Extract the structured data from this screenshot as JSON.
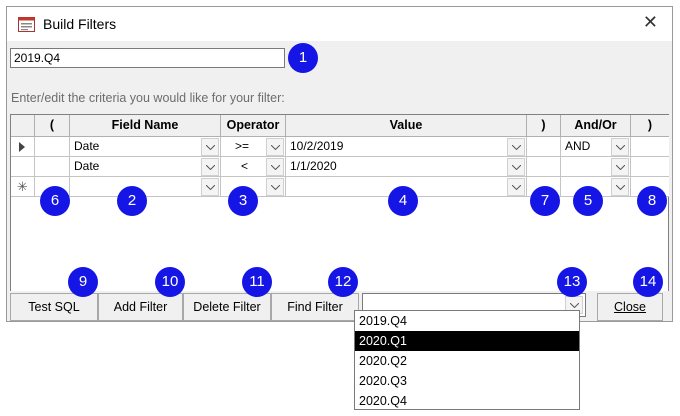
{
  "window": {
    "title": "Build Filters"
  },
  "filter_name": {
    "value": "2019.Q4"
  },
  "hint": "Enter/edit the criteria you would like for your filter:",
  "grid": {
    "headers": [
      "(",
      "Field Name",
      "Operator",
      "Value",
      ")",
      "And/Or",
      ")"
    ],
    "rows": [
      {
        "open_paren": "",
        "field": "Date",
        "operator": ">=",
        "value": "10/2/2019",
        "close_paren": "",
        "and_or": "AND",
        "close2": ""
      },
      {
        "open_paren": "",
        "field": "Date",
        "operator": "<",
        "value": "1/1/2020",
        "close_paren": "",
        "and_or": "",
        "close2": ""
      },
      {
        "open_paren": "",
        "field": "",
        "operator": "",
        "value": "",
        "close_paren": "",
        "and_or": "",
        "close2": ""
      }
    ],
    "new_row_marker": "✳"
  },
  "buttons": {
    "test_sql": "Test SQL",
    "add_filter": "Add Filter",
    "delete_filter": "Delete Filter",
    "find_filter": "Find Filter",
    "close": "Close"
  },
  "find_combo": {
    "value": "",
    "options": [
      "2019.Q4",
      "2020.Q1",
      "2020.Q2",
      "2020.Q3",
      "2020.Q4"
    ],
    "highlighted": "2020.Q1"
  },
  "callouts": [
    "1",
    "2",
    "3",
    "4",
    "5",
    "6",
    "7",
    "8",
    "9",
    "10",
    "11",
    "12",
    "13",
    "14"
  ],
  "colors": {
    "callout": "#1515e6",
    "highlight": "#000000"
  },
  "icons": {
    "app": "form-icon",
    "close": "close-icon",
    "record_selector": "current-record-icon",
    "new_record": "new-record-icon",
    "dropdown": "chevron-down-icon"
  }
}
